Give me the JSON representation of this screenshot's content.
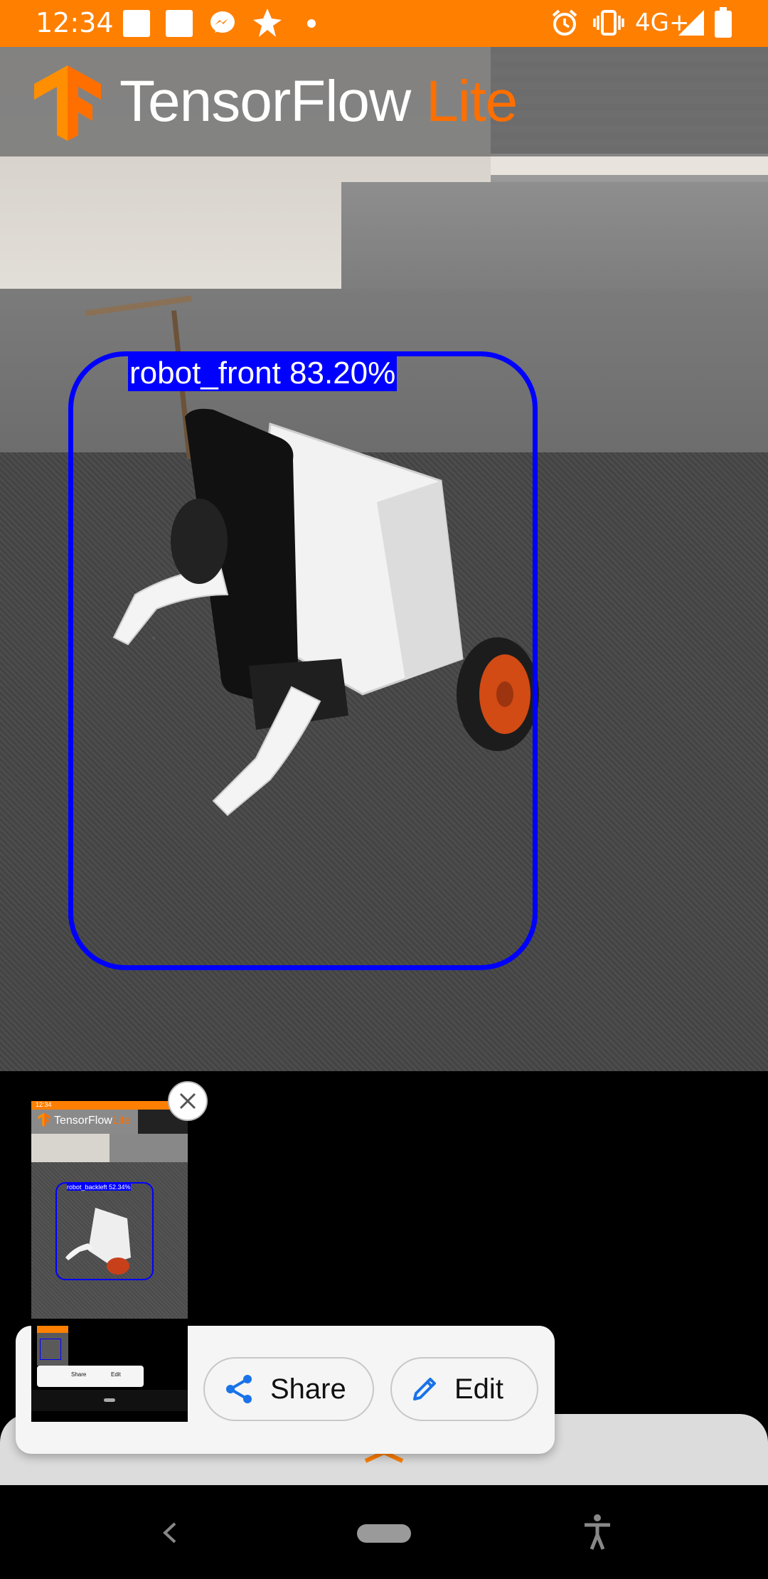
{
  "status_bar": {
    "time": "12:34",
    "network": "4G+",
    "icons": [
      "app-square-icon",
      "app-square-icon",
      "messenger-icon",
      "pinwheel-icon",
      "dot-icon",
      "alarm-icon",
      "vibrate-icon",
      "signal-icon",
      "battery-icon"
    ],
    "bg_color": "#ff7f00"
  },
  "app_header": {
    "title_main": "TensorFlow",
    "title_accent": "Lite",
    "accent_color": "#ff6f00"
  },
  "detection": {
    "label": "robot_front 83.20%",
    "box_color": "#0000ff"
  },
  "screenshot_preview": {
    "thumb_title_main": "TensorFlow",
    "thumb_title_accent": "Lite",
    "thumb_time": "12:34",
    "thumb_label": "robot_backleft 52.34%",
    "mini_share": "Share",
    "mini_edit": "Edit"
  },
  "actions": {
    "share_label": "Share",
    "edit_label": "Edit",
    "accent_color": "#1a73e8"
  },
  "nav_bar": {
    "icons": [
      "back-icon",
      "home-pill-icon",
      "accessibility-icon"
    ]
  }
}
